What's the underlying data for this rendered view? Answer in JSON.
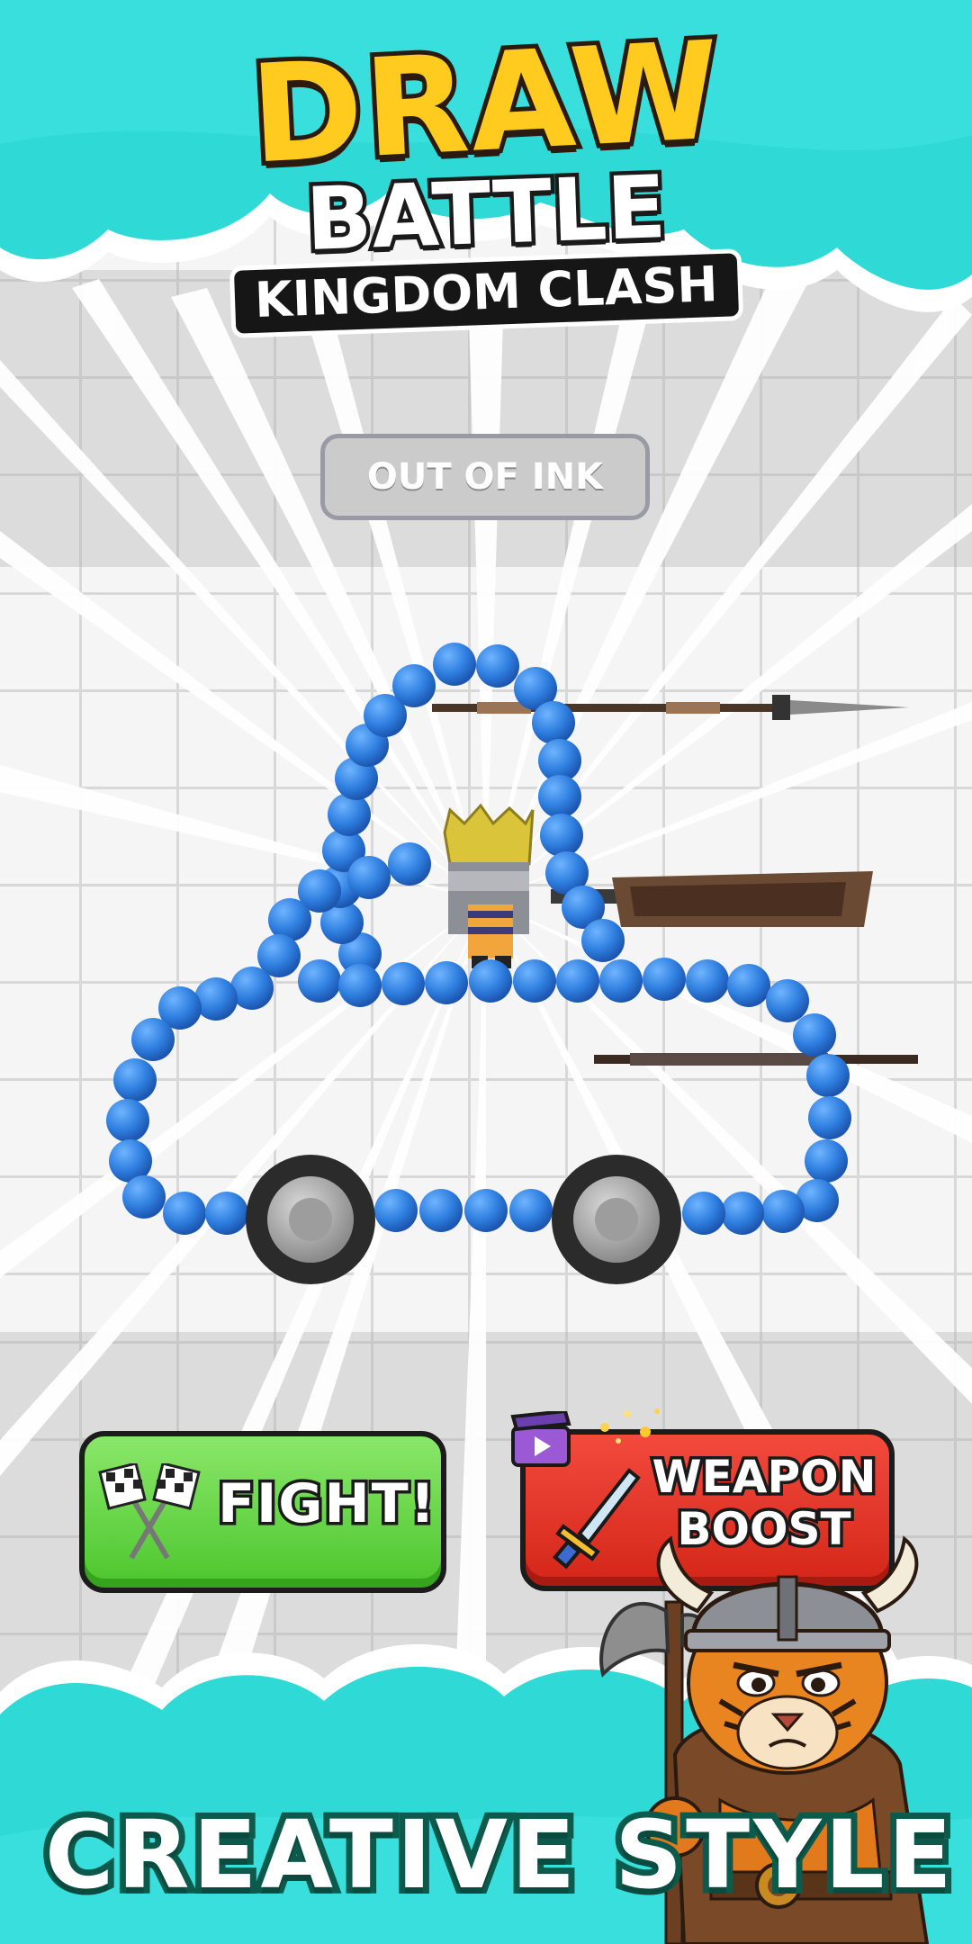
{
  "logo": {
    "line1": "DRAW",
    "line2": "BATTLE",
    "line3": "KINGDOM CLASH"
  },
  "status_button": {
    "label": "OUT OF INK"
  },
  "actions": {
    "fight_label": "FIGHT!",
    "boost_line1": "WEAPON",
    "boost_line2": "BOOST"
  },
  "tagline": "CREATIVE STYLE",
  "colors": {
    "sky_cyan": "#2fd9d6",
    "ink_blue": "#2f7fe0",
    "fight_green": "#5fd13b",
    "boost_red": "#e53527",
    "logo_yellow": "#ffcb1f"
  },
  "icons": {
    "fight": "checkered-flags-icon",
    "boost": "sword-icon",
    "ad": "video-clapper-icon"
  }
}
